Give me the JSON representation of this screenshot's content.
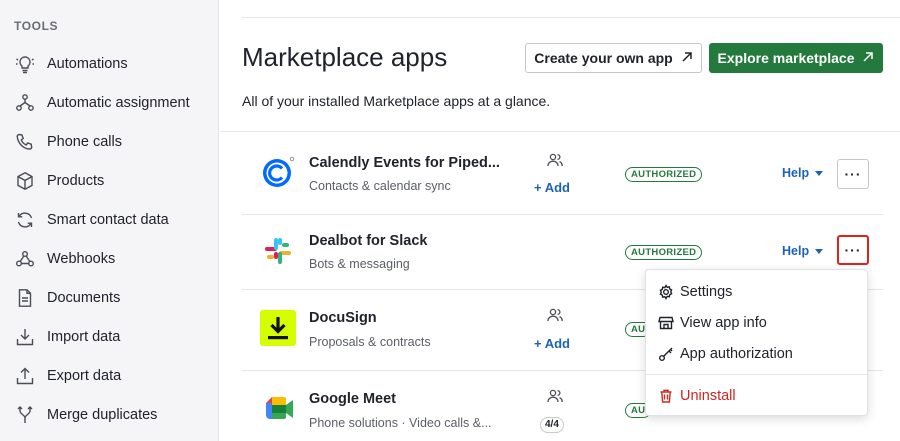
{
  "sidebar": {
    "title": "TOOLS",
    "items": [
      {
        "label": "Automations",
        "icon": "automations-icon"
      },
      {
        "label": "Automatic assignment",
        "icon": "assignment-icon"
      },
      {
        "label": "Phone calls",
        "icon": "phone-icon"
      },
      {
        "label": "Products",
        "icon": "box-icon"
      },
      {
        "label": "Smart contact data",
        "icon": "sync-icon"
      },
      {
        "label": "Webhooks",
        "icon": "webhook-icon"
      },
      {
        "label": "Documents",
        "icon": "document-icon"
      },
      {
        "label": "Import data",
        "icon": "import-icon"
      },
      {
        "label": "Export data",
        "icon": "export-icon"
      },
      {
        "label": "Merge duplicates",
        "icon": "merge-icon"
      }
    ]
  },
  "header": {
    "title": "Marketplace apps",
    "subtitle": "All of your installed Marketplace apps at a glance.",
    "create_label": "Create your own app",
    "explore_label": "Explore marketplace"
  },
  "apps": [
    {
      "name": "Calendly Events for Piped...",
      "category": "Contacts & calendar sync",
      "action": "+ Add",
      "status": "AUTHORIZED",
      "help": "Help",
      "more": "···",
      "logo": "calendly-logo"
    },
    {
      "name": "Dealbot for Slack",
      "category": "Bots & messaging",
      "action": "",
      "status": "AUTHORIZED",
      "help": "Help",
      "more": "···",
      "logo": "slack-logo"
    },
    {
      "name": "DocuSign",
      "category": "Proposals & contracts",
      "action": "+ Add",
      "status": "AU",
      "help": "",
      "more": "",
      "logo": "docusign-logo"
    },
    {
      "name": "Google Meet",
      "category": "Phone solutions · Video calls &...",
      "count": "4/4",
      "status": "AU",
      "help": "",
      "more": "",
      "logo": "google-meet-logo"
    }
  ],
  "menu": {
    "items": [
      {
        "label": "Settings",
        "icon": "gear-icon"
      },
      {
        "label": "View app info",
        "icon": "store-icon"
      },
      {
        "label": "App authorization",
        "icon": "key-icon"
      }
    ],
    "danger": {
      "label": "Uninstall",
      "icon": "trash-icon"
    }
  },
  "colors": {
    "primary_green": "#237a3c",
    "link_blue": "#1b62b8",
    "danger_red": "#d0261f",
    "highlight_red": "#e0211d"
  }
}
